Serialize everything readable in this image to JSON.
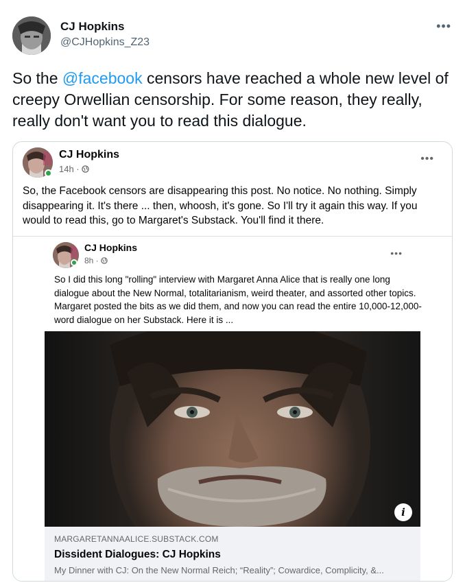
{
  "tweet": {
    "author_name": "CJ Hopkins",
    "author_handle": "@CJHopkins_Z23",
    "more": "•••",
    "text_before": "So the ",
    "mention": "@facebook",
    "text_after": " censors have reached a whole new level of creepy Orwellian censorship. For some reason, they really, really don't want you to read this dialogue."
  },
  "fb_post": {
    "author_name": "CJ Hopkins",
    "time": "14h · ",
    "more": "•••",
    "text": "So, the Facebook censors are disappearing this post. No notice. No nothing. Simply disappearing it. It's there ... then, whoosh, it's gone. So I'll try it again this way. If you would to read this, go to Margaret's Substack. You'll find it there."
  },
  "shared_post": {
    "author_name": "CJ Hopkins",
    "time": "8h · ",
    "more": "•••",
    "text": "So I did this long \"rolling\" interview with Margaret Anna Alice that is really one long dialogue about the New Normal, totalitarianism, weird theater, and assorted other topics. Margaret posted the bits as we did them, and now you can read the entire 10,000-12,000-word dialogue on her Substack. Here it is ...",
    "info_icon": "i",
    "link": {
      "domain": "MARGARETANNAALICE.SUBSTACK.COM",
      "title": "Dissident Dialogues: CJ Hopkins",
      "description": "My Dinner with CJ: On the New Normal Reich; “Reality”; Cowardice, Complicity, &..."
    }
  },
  "colors": {
    "mention": "#1d9bf0",
    "online_dot": "#31a24c",
    "link_bg": "#f0f2f5"
  }
}
